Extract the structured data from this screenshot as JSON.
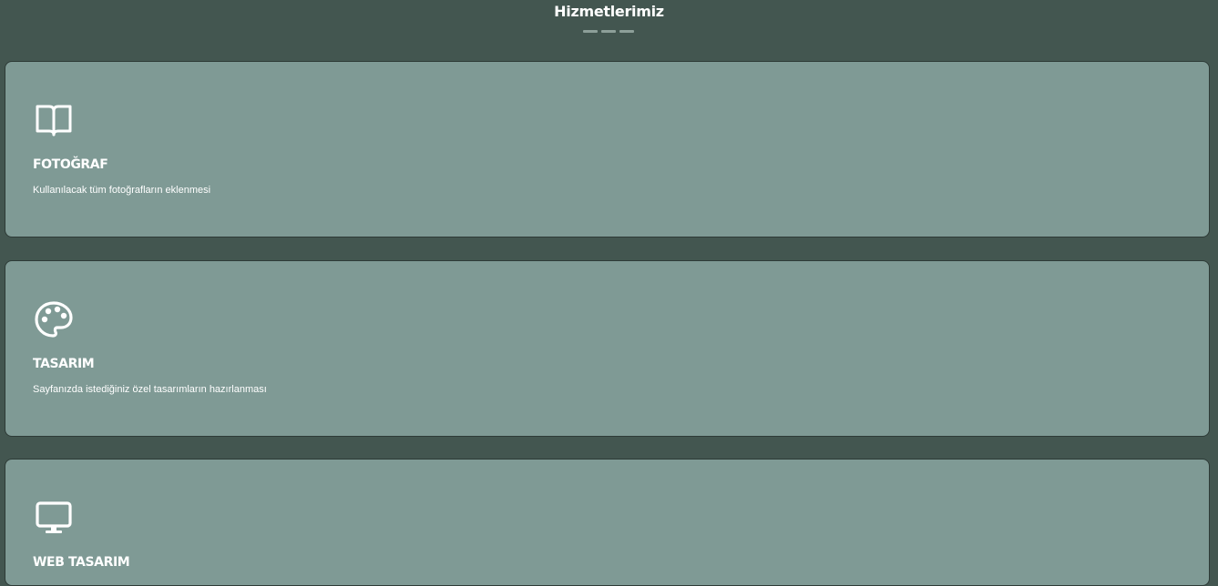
{
  "section": {
    "title": "Hizmetlerimiz"
  },
  "services": [
    {
      "icon": "book-open-icon",
      "title": "FOTOĞRAF",
      "description": "Kullanılacak tüm fotoğrafların eklenmesi"
    },
    {
      "icon": "palette-icon",
      "title": "TASARIM",
      "description": "Sayfanızda istediğiniz özel tasarımların hazırlanması"
    },
    {
      "icon": "monitor-icon",
      "title": "WEB TASARIM",
      "description": ""
    }
  ],
  "colors": {
    "background": "#435650",
    "card": "#7f9a95",
    "divider": "#8d9f99",
    "text": "#ffffff"
  }
}
